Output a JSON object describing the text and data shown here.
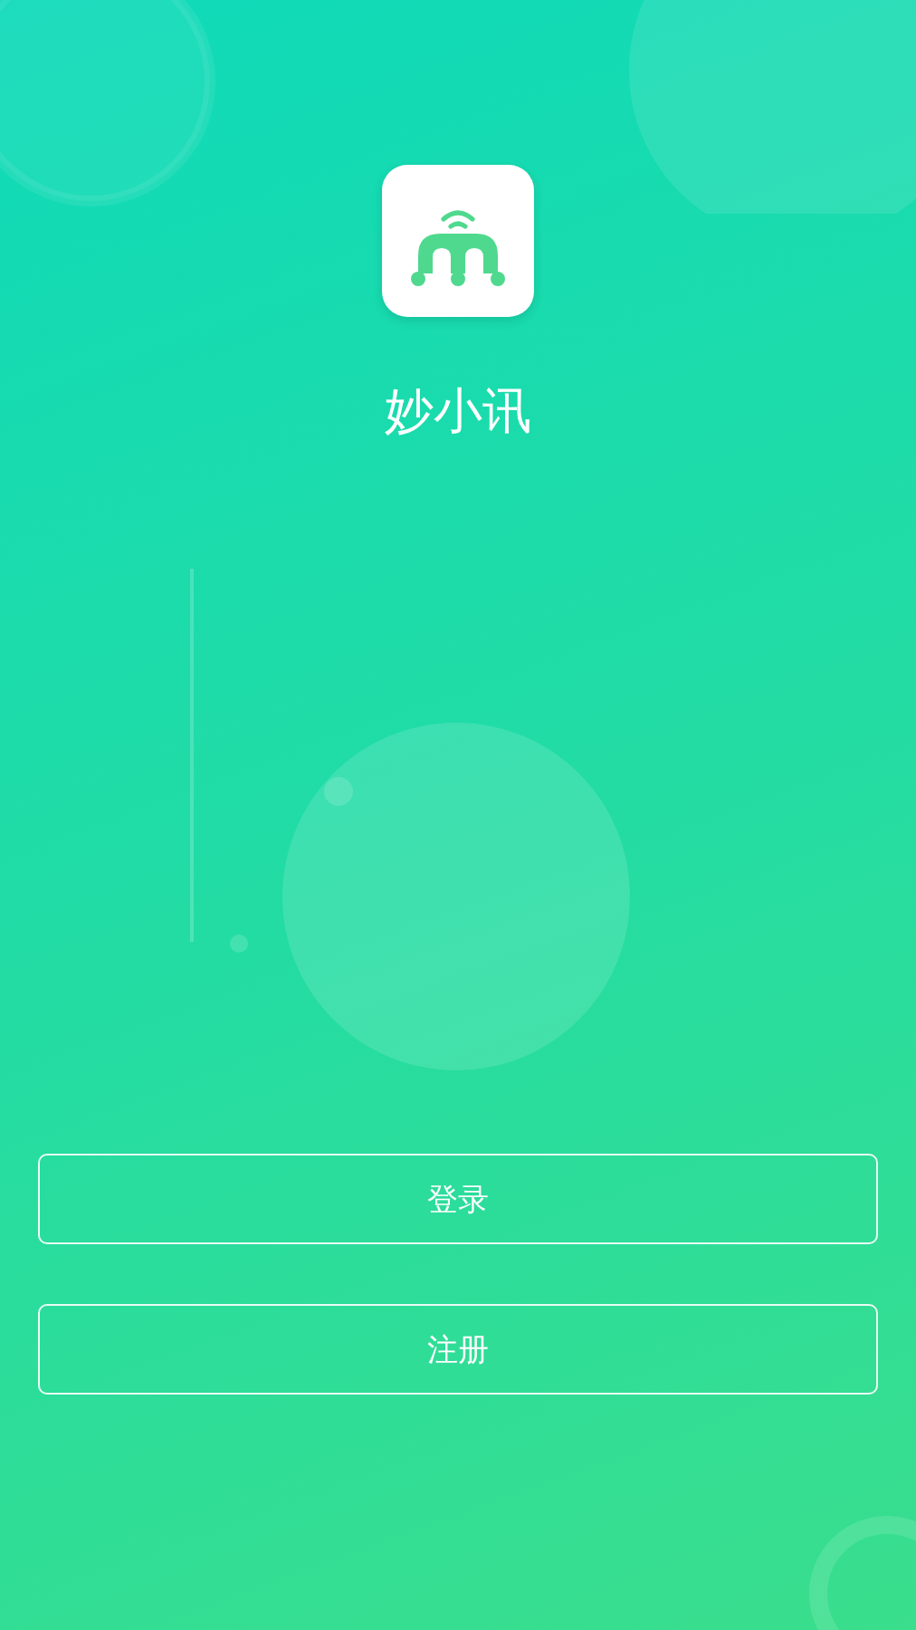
{
  "app": {
    "name": "妙小讯"
  },
  "buttons": [
    {
      "label": "登录"
    },
    {
      "label": "注册"
    }
  ]
}
